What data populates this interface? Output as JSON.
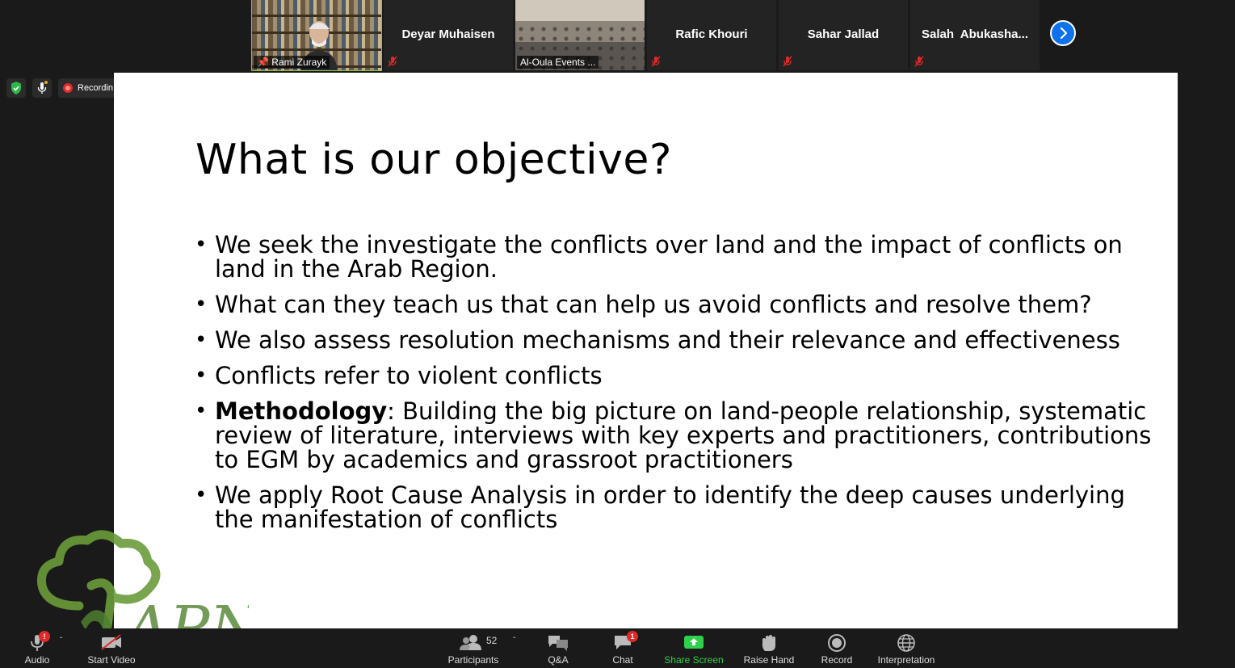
{
  "participants": [
    {
      "name": "Rami Zurayk",
      "type": "video",
      "active": true
    },
    {
      "name": "Deyar Muhaisen",
      "type": "name"
    },
    {
      "name": "Al-Oula Events ...",
      "type": "video"
    },
    {
      "name": "Rafic Khouri",
      "type": "name"
    },
    {
      "name": "Sahar Jallad",
      "type": "name"
    },
    {
      "name": "Salah  Abukasha...",
      "type": "name"
    }
  ],
  "status": {
    "recording_label": "Recordin"
  },
  "slide": {
    "title": "What is our objective?",
    "bullets": [
      {
        "bold": "",
        "text": "We seek the investigate the conflicts over land and the impact of conflicts on land in the Arab Region."
      },
      {
        "bold": "",
        "text": "What can they teach us that can help us avoid conflicts and resolve them?"
      },
      {
        "bold": "",
        "text": "We also assess resolution mechanisms and their relevance and effectiveness"
      },
      {
        "bold": "",
        "text": "Conflicts refer to violent conflicts"
      },
      {
        "bold": "Methodology",
        "text": ": Building the big picture on land-people relationship, systematic review of literature, interviews with key experts and practitioners, contributions to EGM by academics and grassroot practitioners"
      },
      {
        "bold": "",
        "text": "We apply Root Cause Analysis in order to identify the deep causes underlying the manifestation of conflicts"
      }
    ]
  },
  "logo": {
    "text": "APN",
    "color": "#5a8a3c"
  },
  "toolbar": {
    "audio": "Audio",
    "audio_badge": "!",
    "start_video": "Start Video",
    "participants": "Participants",
    "participants_count": "52",
    "qa": "Q&A",
    "chat": "Chat",
    "chat_badge": "1",
    "share_screen": "Share Screen",
    "raise_hand": "Raise Hand",
    "record": "Record",
    "interpretation": "Interpretation"
  },
  "colors": {
    "accent": "#0e72ed",
    "share_green": "#2fd14c",
    "badge_red": "#e02828",
    "active_border": "#8bc34a"
  }
}
